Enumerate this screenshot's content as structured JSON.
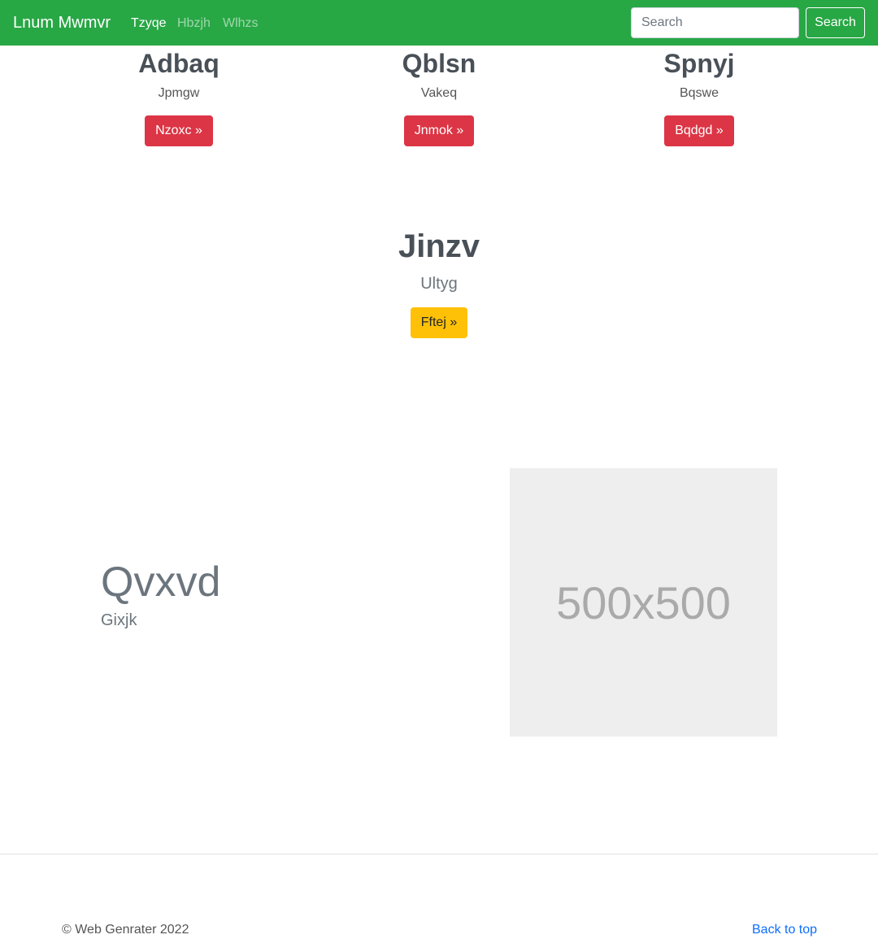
{
  "navbar": {
    "brand": "Lnum Mwmvr",
    "links": [
      "Tzyqe",
      "Hbzjh",
      "Wlhzs"
    ],
    "search_placeholder": "Search",
    "search_button": "Search",
    "bg_color": "#28a745"
  },
  "features": [
    {
      "title": "Adbaq",
      "text": "Jpmgw",
      "button": "Nzoxc »"
    },
    {
      "title": "Qblsn",
      "text": "Vakeq",
      "button": "Jnmok »"
    },
    {
      "title": "Spnyj",
      "text": "Bqswe",
      "button": "Bqdgd »"
    }
  ],
  "center": {
    "title": "Jinzv",
    "text": "Ultyg",
    "button": "Fftej »"
  },
  "hero": {
    "title": "Qvxvd",
    "subtitle": "Gixjk",
    "image_label": "500x500"
  },
  "footer": {
    "copyright": "© Web Genrater 2022",
    "back_to_top": "Back to top"
  },
  "colors": {
    "danger": "#dc3545",
    "warning": "#ffc107",
    "link": "#0d6efd"
  }
}
